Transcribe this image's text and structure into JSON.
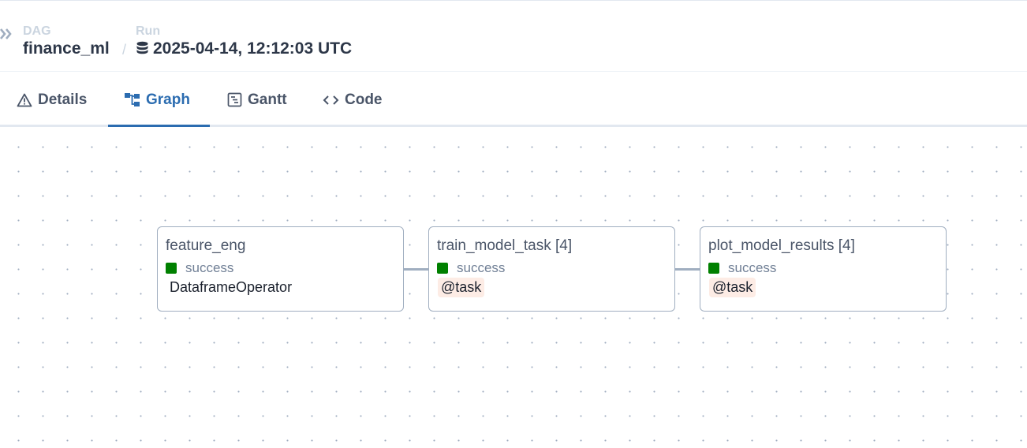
{
  "breadcrumb": {
    "dag_label": "DAG",
    "dag_name": "finance_ml",
    "separator": "/",
    "run_label": "Run",
    "run_value": "2025-04-14, 12:12:03 UTC"
  },
  "tabs": [
    {
      "label": "Details",
      "icon": "warning-icon",
      "active": false
    },
    {
      "label": "Graph",
      "icon": "graph-icon",
      "active": true
    },
    {
      "label": "Gantt",
      "icon": "gantt-icon",
      "active": false
    },
    {
      "label": "Code",
      "icon": "code-icon",
      "active": false
    }
  ],
  "graph": {
    "nodes": [
      {
        "title": "feature_eng",
        "state": "success",
        "operator": "DataframeOperator"
      },
      {
        "title": "train_model_task [4]",
        "state": "success",
        "operator": "@task"
      },
      {
        "title": "plot_model_results [4]",
        "state": "success",
        "operator": "@task"
      }
    ]
  },
  "colors": {
    "success": "#008000",
    "accent": "#2b6cb0",
    "decorator_bg": "#fdece5"
  }
}
